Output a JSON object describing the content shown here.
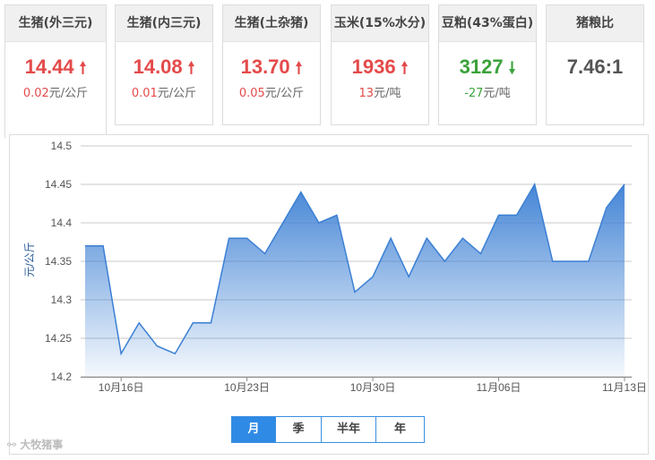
{
  "cards": [
    {
      "title": "生猪(外三元)",
      "value": "14.44",
      "trend": "up",
      "change": "0.02",
      "unit": "元/公斤"
    },
    {
      "title": "生猪(内三元)",
      "value": "14.08",
      "trend": "up",
      "change": "0.01",
      "unit": "元/公斤"
    },
    {
      "title": "生猪(土杂猪)",
      "value": "13.70",
      "trend": "up",
      "change": "0.05",
      "unit": "元/公斤"
    },
    {
      "title": "玉米(15%水分)",
      "value": "1936",
      "trend": "up",
      "change": "13",
      "unit": "元/吨"
    },
    {
      "title": "豆粕(43%蛋白)",
      "value": "3127",
      "trend": "down",
      "change": "-27",
      "unit": "元/吨"
    },
    {
      "title": "猪粮比",
      "value": "7.46:1",
      "trend": "flat",
      "change": "",
      "unit": ""
    }
  ],
  "icons": {
    "up": "arrow-up-icon",
    "down": "arrow-down-icon"
  },
  "colors": {
    "up": "#e44a4a",
    "down": "#3aa23a",
    "line": "#3b7fd4",
    "tab_selected": "#2f8ae5"
  },
  "tabs": [
    {
      "label": "月",
      "selected": true
    },
    {
      "label": "季",
      "selected": false
    },
    {
      "label": "半年",
      "selected": false
    },
    {
      "label": "年",
      "selected": false
    }
  ],
  "watermark": "大牧猪事",
  "chart_data": {
    "type": "area",
    "ylabel": "元/公斤",
    "ylim": [
      14.2,
      14.5
    ],
    "yticks": [
      14.2,
      14.25,
      14.3,
      14.35,
      14.4,
      14.45,
      14.5
    ],
    "ytick_labels": [
      "14.2",
      "14.25",
      "14.3",
      "14.35",
      "14.4",
      "14.45",
      "14.5"
    ],
    "x": [
      "2023-10-14",
      "2023-10-15",
      "2023-10-16",
      "2023-10-17",
      "2023-10-18",
      "2023-10-19",
      "2023-10-20",
      "2023-10-21",
      "2023-10-22",
      "2023-10-23",
      "2023-10-24",
      "2023-10-25",
      "2023-10-26",
      "2023-10-27",
      "2023-10-28",
      "2023-10-29",
      "2023-10-30",
      "2023-10-31",
      "2023-11-01",
      "2023-11-02",
      "2023-11-03",
      "2023-11-04",
      "2023-11-05",
      "2023-11-06",
      "2023-11-07",
      "2023-11-08",
      "2023-11-09",
      "2023-11-10",
      "2023-11-11",
      "2023-11-12",
      "2023-11-13"
    ],
    "values": [
      14.37,
      14.37,
      14.23,
      14.27,
      14.24,
      14.23,
      14.27,
      14.27,
      14.38,
      14.38,
      14.36,
      14.4,
      14.44,
      14.4,
      14.41,
      14.31,
      14.33,
      14.38,
      14.33,
      14.38,
      14.35,
      14.38,
      14.36,
      14.41,
      14.41,
      14.45,
      14.35,
      14.35,
      14.35,
      14.42,
      14.45
    ],
    "xticks": [
      {
        "index": 2,
        "label": "10月16日"
      },
      {
        "index": 9,
        "label": "10月23日"
      },
      {
        "index": 16,
        "label": "10月30日"
      },
      {
        "index": 23,
        "label": "11月06日"
      },
      {
        "index": 30,
        "label": "11月13日"
      }
    ],
    "grid": true
  }
}
